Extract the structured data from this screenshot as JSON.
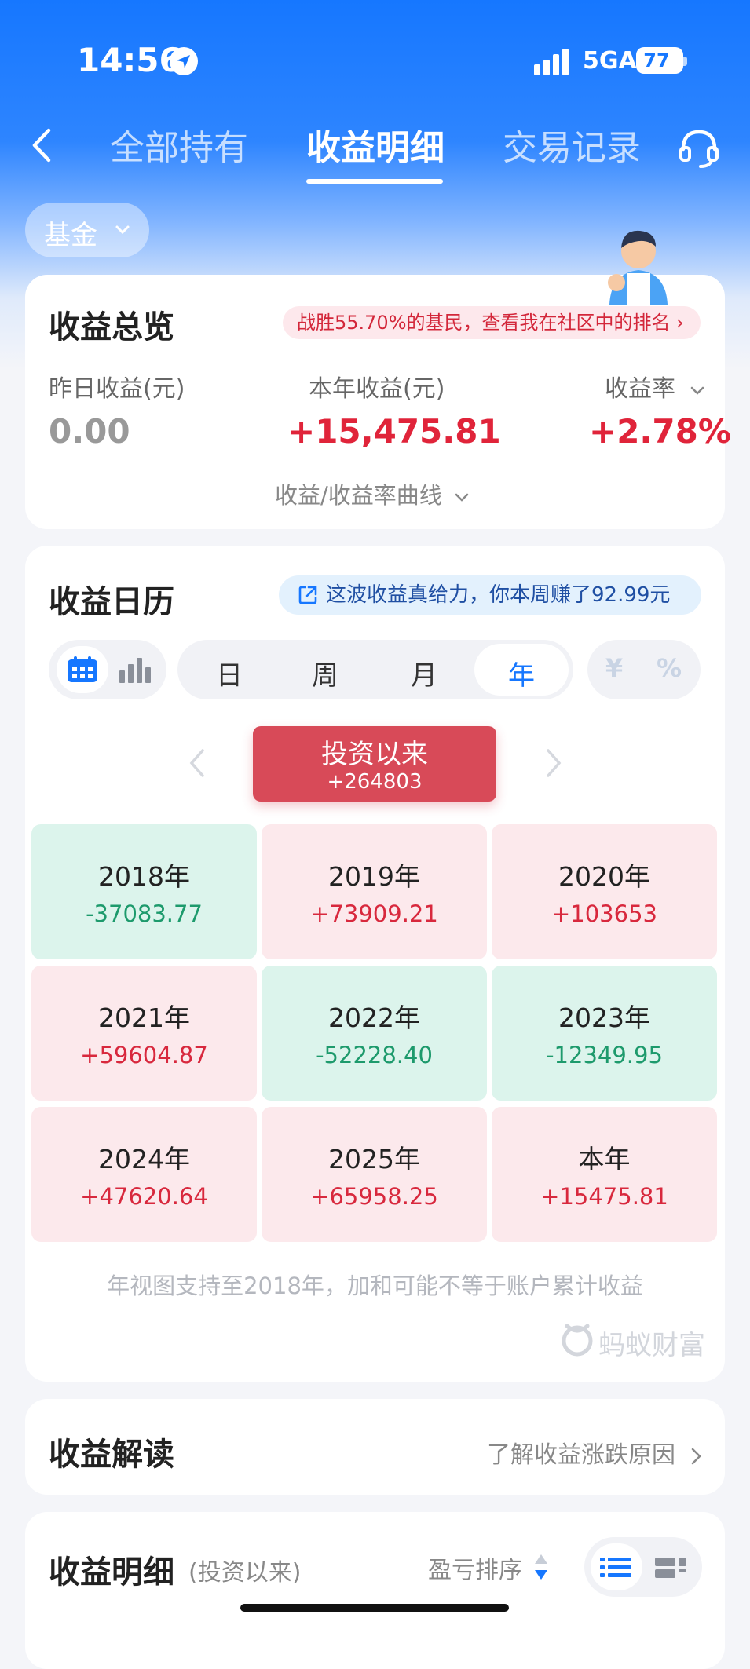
{
  "status_bar": {
    "time": "14:56",
    "network": "5GA",
    "battery": "77"
  },
  "nav": {
    "tabs": [
      {
        "label": "全部持有"
      },
      {
        "label": "收益明细"
      },
      {
        "label": "交易记录"
      }
    ],
    "active_tab": "收益明细"
  },
  "filter": {
    "label": "基金"
  },
  "overview": {
    "title": "收益总览",
    "rank_badge": "战胜55.70%的基民，查看我在社区中的排名 ›",
    "yesterday_label": "昨日收益(元)",
    "yesterday_value": "0.00",
    "year_label": "本年收益(元)",
    "year_value": "+15,475.81",
    "rate_label": "收益率",
    "rate_value": "+2.78%",
    "curve_link": "收益/收益率曲线"
  },
  "calendar": {
    "title": "收益日历",
    "promo": "这波收益真给力，你本周赚了92.99元",
    "periods": [
      "日",
      "周",
      "月",
      "年"
    ],
    "active_period": "年",
    "units": [
      "¥",
      "%"
    ],
    "range_title": "投资以来",
    "range_value": "+264803",
    "years": [
      {
        "name": "2018年",
        "value": "-37083.77",
        "sign": "neg"
      },
      {
        "name": "2019年",
        "value": "+73909.21",
        "sign": "pos"
      },
      {
        "name": "2020年",
        "value": "+103653",
        "sign": "pos"
      },
      {
        "name": "2021年",
        "value": "+59604.87",
        "sign": "pos"
      },
      {
        "name": "2022年",
        "value": "-52228.40",
        "sign": "neg"
      },
      {
        "name": "2023年",
        "value": "-12349.95",
        "sign": "neg"
      },
      {
        "name": "2024年",
        "value": "+47620.64",
        "sign": "pos"
      },
      {
        "name": "2025年",
        "value": "+65958.25",
        "sign": "pos"
      },
      {
        "name": "本年",
        "value": "+15475.81",
        "sign": "pos"
      }
    ],
    "footnote": "年视图支持至2018年，加和可能不等于账户累计收益",
    "brand": "蚂蚁财富"
  },
  "interpretation": {
    "title": "收益解读",
    "link": "了解收益涨跌原因"
  },
  "detail": {
    "title": "收益明细",
    "subtitle": "(投资以来)",
    "sort_label": "盈亏排序"
  },
  "colors": {
    "primary": "#1677ff",
    "gain": "#e0243a",
    "loss": "#1d9a6c",
    "range_box": "#d84a58"
  }
}
